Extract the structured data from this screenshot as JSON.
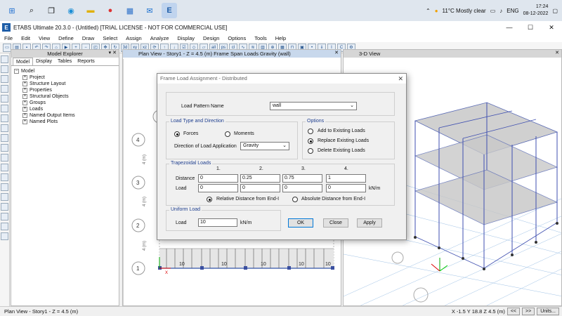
{
  "taskbar": {
    "weather": "11°C  Mostly clear",
    "language": "ENG",
    "time": "17:24",
    "date": "08-12-2022"
  },
  "window": {
    "title": "ETABS Ultimate 20.3.0 - (Untitled)  [TRIAL LICENSE - NOT FOR COMMERCIAL USE]"
  },
  "menu": [
    "File",
    "Edit",
    "View",
    "Define",
    "Draw",
    "Select",
    "Assign",
    "Analyze",
    "Display",
    "Design",
    "Options",
    "Tools",
    "Help"
  ],
  "explorer": {
    "title": "Model Explorer",
    "tabs": [
      "Model",
      "Display",
      "Tables",
      "Reports"
    ],
    "root": "Model",
    "items": [
      "Project",
      "Structure Layout",
      "Properties",
      "Structural Objects",
      "Groups",
      "Loads",
      "Named Output Items",
      "Named Plots"
    ]
  },
  "planview": {
    "title": "Plan View - Story1 - Z = 4.5 (m)  Frame Span Loads Gravity (wall)",
    "grid_labels": [
      "4",
      "3",
      "2",
      "1"
    ],
    "dim_labels": [
      "4 (m)",
      "4 (m)",
      "4 (m)"
    ],
    "span_labels": [
      "10",
      "10",
      "10",
      "10",
      "10"
    ]
  },
  "view3d": {
    "title": "3-D View"
  },
  "dialog": {
    "title": "Frame Load Assignment - Distributed",
    "load_pattern_label": "Load Pattern Name",
    "load_pattern_value": "wall",
    "load_type_legend": "Load Type and Direction",
    "forces_label": "Forces",
    "moments_label": "Moments",
    "direction_label": "Direction of Load Application",
    "direction_value": "Gravity",
    "options_legend": "Options",
    "add_label": "Add to Existing Loads",
    "replace_label": "Replace Existing Loads",
    "delete_label": "Delete Existing Loads",
    "trap_legend": "Trapezoidal Loads",
    "col_headers": [
      "1.",
      "2.",
      "3.",
      "4."
    ],
    "distance_label": "Distance",
    "load_label": "Load",
    "distances": [
      "0",
      "0.25",
      "0.75",
      "1"
    ],
    "loads": [
      "0",
      "0",
      "0",
      "0"
    ],
    "load_unit": "kN/m",
    "relative_label": "Relative Distance from End-I",
    "absolute_label": "Absolute Distance from End-I",
    "uniform_legend": "Uniform Load",
    "uniform_load_label": "Load",
    "uniform_value": "10",
    "uniform_unit": "kN/m",
    "ok": "OK",
    "close": "Close",
    "apply": "Apply"
  },
  "status": {
    "left": "Plan View - Story1 - Z = 4.5 (m)",
    "coords": "X -1.5  Y 18.8  Z 4.5 (m)",
    "units": "Units..."
  }
}
